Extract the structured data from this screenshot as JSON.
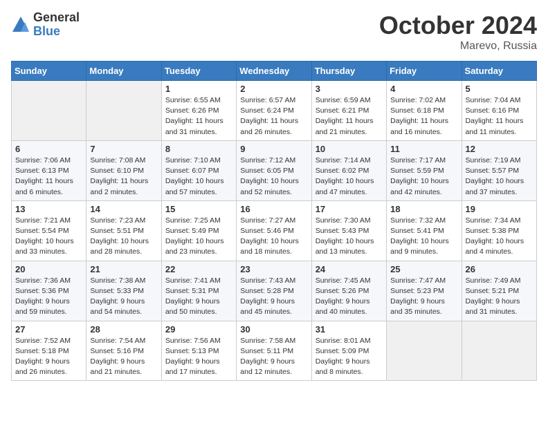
{
  "logo": {
    "general": "General",
    "blue": "Blue"
  },
  "header": {
    "month": "October 2024",
    "location": "Marevo, Russia"
  },
  "weekdays": [
    "Sunday",
    "Monday",
    "Tuesday",
    "Wednesday",
    "Thursday",
    "Friday",
    "Saturday"
  ],
  "weeks": [
    [
      {
        "day": "",
        "sunrise": "",
        "sunset": "",
        "daylight": ""
      },
      {
        "day": "",
        "sunrise": "",
        "sunset": "",
        "daylight": ""
      },
      {
        "day": "1",
        "sunrise": "Sunrise: 6:55 AM",
        "sunset": "Sunset: 6:26 PM",
        "daylight": "Daylight: 11 hours and 31 minutes."
      },
      {
        "day": "2",
        "sunrise": "Sunrise: 6:57 AM",
        "sunset": "Sunset: 6:24 PM",
        "daylight": "Daylight: 11 hours and 26 minutes."
      },
      {
        "day": "3",
        "sunrise": "Sunrise: 6:59 AM",
        "sunset": "Sunset: 6:21 PM",
        "daylight": "Daylight: 11 hours and 21 minutes."
      },
      {
        "day": "4",
        "sunrise": "Sunrise: 7:02 AM",
        "sunset": "Sunset: 6:18 PM",
        "daylight": "Daylight: 11 hours and 16 minutes."
      },
      {
        "day": "5",
        "sunrise": "Sunrise: 7:04 AM",
        "sunset": "Sunset: 6:16 PM",
        "daylight": "Daylight: 11 hours and 11 minutes."
      }
    ],
    [
      {
        "day": "6",
        "sunrise": "Sunrise: 7:06 AM",
        "sunset": "Sunset: 6:13 PM",
        "daylight": "Daylight: 11 hours and 6 minutes."
      },
      {
        "day": "7",
        "sunrise": "Sunrise: 7:08 AM",
        "sunset": "Sunset: 6:10 PM",
        "daylight": "Daylight: 11 hours and 2 minutes."
      },
      {
        "day": "8",
        "sunrise": "Sunrise: 7:10 AM",
        "sunset": "Sunset: 6:07 PM",
        "daylight": "Daylight: 10 hours and 57 minutes."
      },
      {
        "day": "9",
        "sunrise": "Sunrise: 7:12 AM",
        "sunset": "Sunset: 6:05 PM",
        "daylight": "Daylight: 10 hours and 52 minutes."
      },
      {
        "day": "10",
        "sunrise": "Sunrise: 7:14 AM",
        "sunset": "Sunset: 6:02 PM",
        "daylight": "Daylight: 10 hours and 47 minutes."
      },
      {
        "day": "11",
        "sunrise": "Sunrise: 7:17 AM",
        "sunset": "Sunset: 5:59 PM",
        "daylight": "Daylight: 10 hours and 42 minutes."
      },
      {
        "day": "12",
        "sunrise": "Sunrise: 7:19 AM",
        "sunset": "Sunset: 5:57 PM",
        "daylight": "Daylight: 10 hours and 37 minutes."
      }
    ],
    [
      {
        "day": "13",
        "sunrise": "Sunrise: 7:21 AM",
        "sunset": "Sunset: 5:54 PM",
        "daylight": "Daylight: 10 hours and 33 minutes."
      },
      {
        "day": "14",
        "sunrise": "Sunrise: 7:23 AM",
        "sunset": "Sunset: 5:51 PM",
        "daylight": "Daylight: 10 hours and 28 minutes."
      },
      {
        "day": "15",
        "sunrise": "Sunrise: 7:25 AM",
        "sunset": "Sunset: 5:49 PM",
        "daylight": "Daylight: 10 hours and 23 minutes."
      },
      {
        "day": "16",
        "sunrise": "Sunrise: 7:27 AM",
        "sunset": "Sunset: 5:46 PM",
        "daylight": "Daylight: 10 hours and 18 minutes."
      },
      {
        "day": "17",
        "sunrise": "Sunrise: 7:30 AM",
        "sunset": "Sunset: 5:43 PM",
        "daylight": "Daylight: 10 hours and 13 minutes."
      },
      {
        "day": "18",
        "sunrise": "Sunrise: 7:32 AM",
        "sunset": "Sunset: 5:41 PM",
        "daylight": "Daylight: 10 hours and 9 minutes."
      },
      {
        "day": "19",
        "sunrise": "Sunrise: 7:34 AM",
        "sunset": "Sunset: 5:38 PM",
        "daylight": "Daylight: 10 hours and 4 minutes."
      }
    ],
    [
      {
        "day": "20",
        "sunrise": "Sunrise: 7:36 AM",
        "sunset": "Sunset: 5:36 PM",
        "daylight": "Daylight: 9 hours and 59 minutes."
      },
      {
        "day": "21",
        "sunrise": "Sunrise: 7:38 AM",
        "sunset": "Sunset: 5:33 PM",
        "daylight": "Daylight: 9 hours and 54 minutes."
      },
      {
        "day": "22",
        "sunrise": "Sunrise: 7:41 AM",
        "sunset": "Sunset: 5:31 PM",
        "daylight": "Daylight: 9 hours and 50 minutes."
      },
      {
        "day": "23",
        "sunrise": "Sunrise: 7:43 AM",
        "sunset": "Sunset: 5:28 PM",
        "daylight": "Daylight: 9 hours and 45 minutes."
      },
      {
        "day": "24",
        "sunrise": "Sunrise: 7:45 AM",
        "sunset": "Sunset: 5:26 PM",
        "daylight": "Daylight: 9 hours and 40 minutes."
      },
      {
        "day": "25",
        "sunrise": "Sunrise: 7:47 AM",
        "sunset": "Sunset: 5:23 PM",
        "daylight": "Daylight: 9 hours and 35 minutes."
      },
      {
        "day": "26",
        "sunrise": "Sunrise: 7:49 AM",
        "sunset": "Sunset: 5:21 PM",
        "daylight": "Daylight: 9 hours and 31 minutes."
      }
    ],
    [
      {
        "day": "27",
        "sunrise": "Sunrise: 7:52 AM",
        "sunset": "Sunset: 5:18 PM",
        "daylight": "Daylight: 9 hours and 26 minutes."
      },
      {
        "day": "28",
        "sunrise": "Sunrise: 7:54 AM",
        "sunset": "Sunset: 5:16 PM",
        "daylight": "Daylight: 9 hours and 21 minutes."
      },
      {
        "day": "29",
        "sunrise": "Sunrise: 7:56 AM",
        "sunset": "Sunset: 5:13 PM",
        "daylight": "Daylight: 9 hours and 17 minutes."
      },
      {
        "day": "30",
        "sunrise": "Sunrise: 7:58 AM",
        "sunset": "Sunset: 5:11 PM",
        "daylight": "Daylight: 9 hours and 12 minutes."
      },
      {
        "day": "31",
        "sunrise": "Sunrise: 8:01 AM",
        "sunset": "Sunset: 5:09 PM",
        "daylight": "Daylight: 9 hours and 8 minutes."
      },
      {
        "day": "",
        "sunrise": "",
        "sunset": "",
        "daylight": ""
      },
      {
        "day": "",
        "sunrise": "",
        "sunset": "",
        "daylight": ""
      }
    ]
  ]
}
